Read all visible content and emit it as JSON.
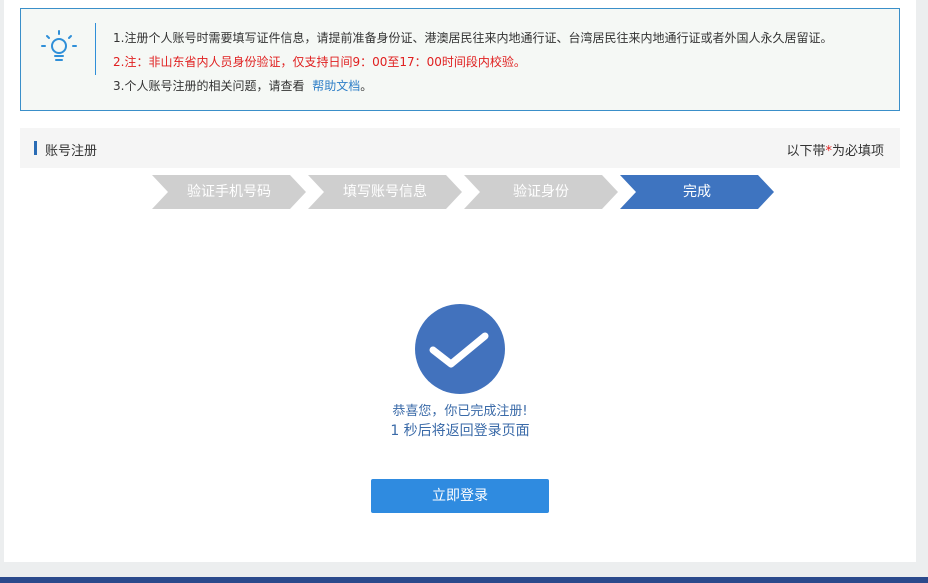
{
  "notice": {
    "icon": "lightbulb-icon",
    "line1": "1.注册个人账号时需要填写证件信息，请提前准备身份证、港澳居民往来内地通行证、台湾居民往来内地通行证或者外国人永久居留证。",
    "line2": "2.注：非山东省内人员身份验证，仅支持日间9：00至17：00时间段内校验。",
    "line3_prefix": "3.个人账号注册的相关问题，请查看",
    "help_link": "帮助文档",
    "line3_suffix": "。"
  },
  "section": {
    "title": "账号注册",
    "required_prefix": "以下带",
    "required_star": "*",
    "required_suffix": "为必填项"
  },
  "steps": [
    {
      "label": "验证手机号码",
      "state": "done"
    },
    {
      "label": "填写账号信息",
      "state": "done"
    },
    {
      "label": "验证身份",
      "state": "done"
    },
    {
      "label": "完成",
      "state": "active"
    }
  ],
  "result": {
    "icon": "checkmark-icon",
    "message": "恭喜您，你已完成注册!",
    "countdown": "1 秒后将返回登录页面"
  },
  "login_button": "立即登录",
  "colors": {
    "accent": "#3e74c0",
    "button": "#2f8be0",
    "warning": "#e02020",
    "step_done": "#cfcfcf"
  }
}
